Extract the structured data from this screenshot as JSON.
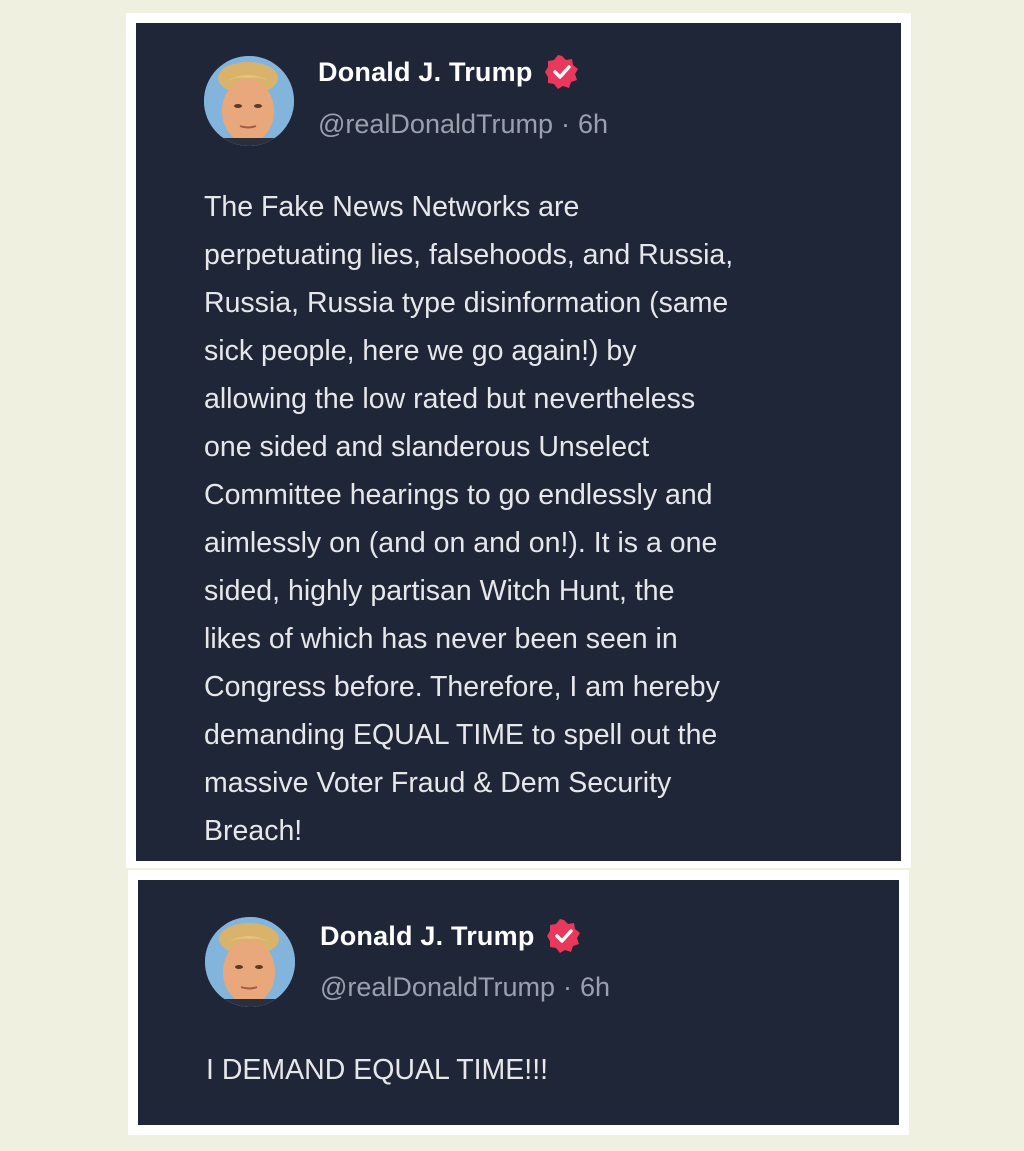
{
  "posts": [
    {
      "author": {
        "display_name": "Donald J. Trump",
        "handle": "@realDonaldTrump",
        "separator": "·",
        "time_ago": "6h",
        "verified_icon": "verified-badge-icon",
        "verified_color": "#e8395c"
      },
      "text": "The Fake News Networks are\nperpetuating lies, falsehoods, and Russia,\nRussia, Russia type disinformation (same\nsick people, here we go again!) by\nallowing the low rated but nevertheless\none sided and slanderous Unselect\nCommittee hearings to go endlessly and\naimlessly on (and on and on!). It is a one\nsided, highly partisan Witch Hunt, the\nlikes of which has never been seen in\nCongress before. Therefore, I am hereby\ndemanding EQUAL TIME to spell out the\nmassive Voter Fraud & Dem Security\nBreach!"
    },
    {
      "author": {
        "display_name": "Donald J. Trump",
        "handle": "@realDonaldTrump",
        "separator": "·",
        "time_ago": "6h",
        "verified_icon": "verified-badge-icon",
        "verified_color": "#e8395c"
      },
      "text": "I DEMAND EQUAL TIME!!!"
    }
  ],
  "colors": {
    "page_background": "#f0f0e1",
    "card_background": "#1f2638",
    "frame": "#ffffff",
    "name_text": "#ffffff",
    "meta_text": "#9aa0ad",
    "body_text": "#e6e7ea"
  }
}
